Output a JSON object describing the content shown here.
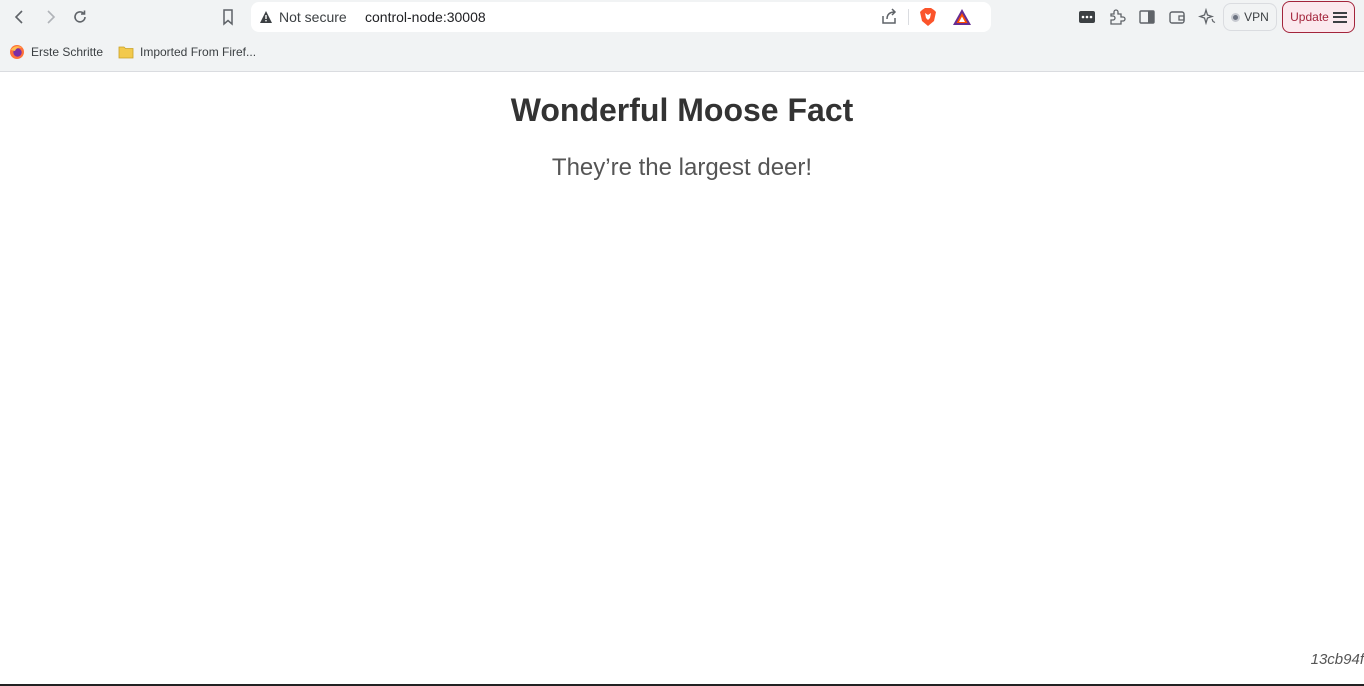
{
  "browser": {
    "address_bar": {
      "security_label": "Not secure",
      "url": "control-node:30008"
    },
    "vpn_label": "VPN",
    "update_label": "Update",
    "icons": {
      "back": "arrow-left-icon",
      "forward": "arrow-right-icon",
      "reload": "reload-icon",
      "bookmark": "bookmark-icon",
      "warning": "warning-triangle-icon",
      "share": "share-icon",
      "brave": "brave-shields-icon",
      "rewards": "brave-rewards-icon",
      "extensions": [
        "password-manager-icon",
        "puzzle-extensions-icon",
        "sidebar-icon",
        "wallet-icon",
        "leo-ai-icon"
      ],
      "menu": "hamburger-menu-icon"
    },
    "bookmarks": [
      {
        "label": "Erste Schritte",
        "icon": "firefox-icon"
      },
      {
        "label": "Imported From Firef...",
        "icon": "folder-icon"
      }
    ],
    "colors": {
      "update_accent": "#a3243b",
      "toolbar_bg": "#f1f3f4"
    }
  },
  "page": {
    "title": "Wonderful Moose Fact",
    "fact": "They’re the largest deer!",
    "hash": "13cb94f"
  }
}
